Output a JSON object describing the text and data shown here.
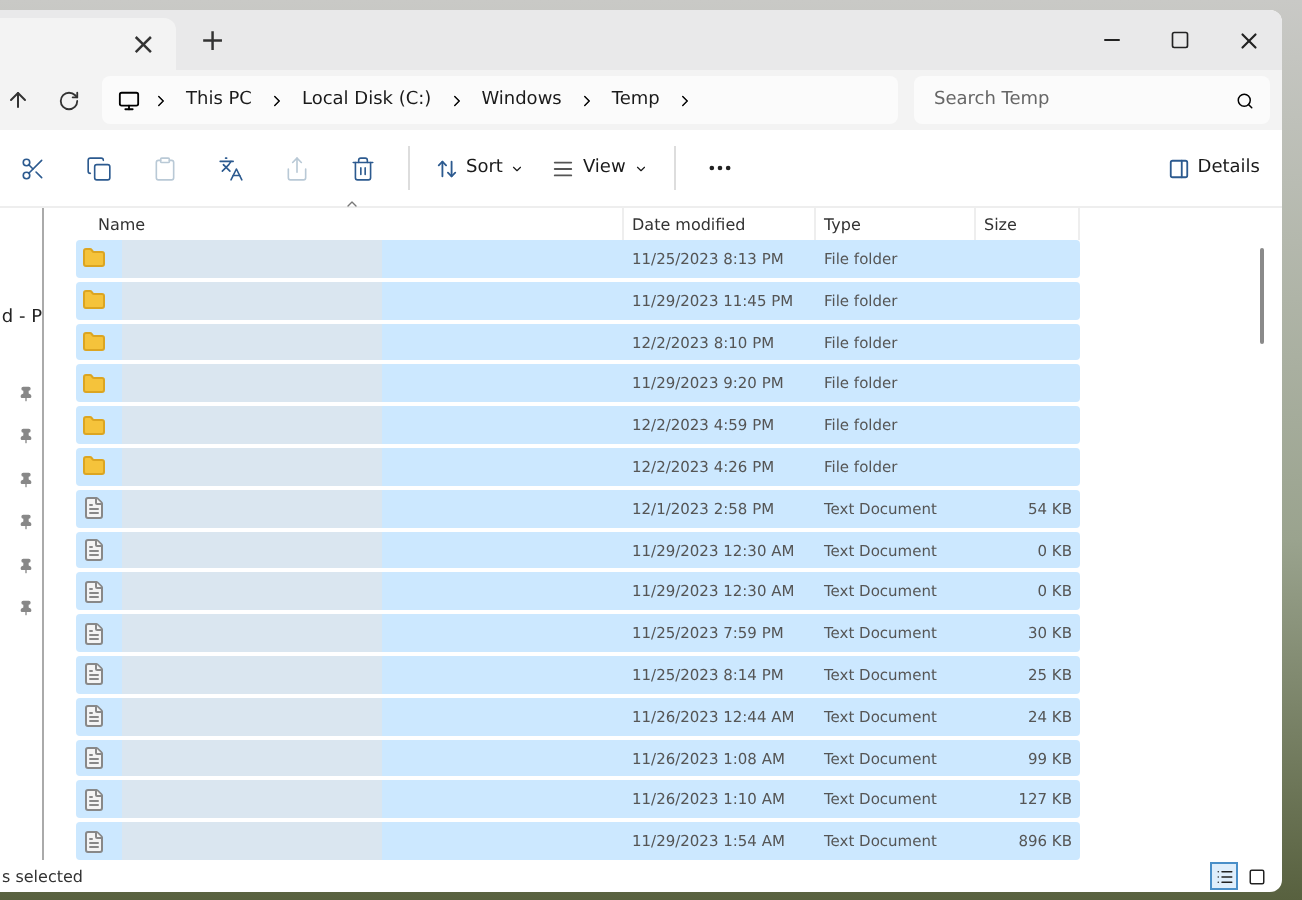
{
  "window": {
    "tab_close": "×",
    "new_tab": "+"
  },
  "address": {
    "crumbs": [
      "This PC",
      "Local Disk (C:)",
      "Windows",
      "Temp"
    ],
    "search_placeholder": "Search Temp"
  },
  "toolbar": {
    "actions": [
      {
        "kind": "cut",
        "disabled": false
      },
      {
        "kind": "copy",
        "disabled": false
      },
      {
        "kind": "paste",
        "disabled": true
      },
      {
        "kind": "rename",
        "disabled": false
      },
      {
        "kind": "share",
        "disabled": true
      },
      {
        "kind": "delete",
        "disabled": false
      }
    ],
    "sort": "Sort",
    "view": "View",
    "details": "Details"
  },
  "sidebar": {
    "fragment": "d - P",
    "items": [
      {
        "pinned": true
      },
      {
        "pinned": true
      },
      {
        "pinned": true
      },
      {
        "pinned": true
      },
      {
        "pinned": true
      },
      {
        "pinned": true
      }
    ]
  },
  "columns": [
    {
      "label": "Name",
      "sorted": true
    },
    {
      "label": "Date modified",
      "sorted": false
    },
    {
      "label": "Type",
      "sorted": false
    },
    {
      "label": "Size",
      "sorted": false
    }
  ],
  "rows": [
    {
      "kind": "folder",
      "date": "11/25/2023 8:13 PM",
      "type": "File folder",
      "size": "",
      "selected": true
    },
    {
      "kind": "folder",
      "date": "11/29/2023 11:45 PM",
      "type": "File folder",
      "size": "",
      "selected": true
    },
    {
      "kind": "folder",
      "date": "12/2/2023 8:10 PM",
      "type": "File folder",
      "size": "",
      "selected": true
    },
    {
      "kind": "folder",
      "date": "11/29/2023 9:20 PM",
      "type": "File folder",
      "size": "",
      "selected": true
    },
    {
      "kind": "folder",
      "date": "12/2/2023 4:59 PM",
      "type": "File folder",
      "size": "",
      "selected": true
    },
    {
      "kind": "folder",
      "date": "12/2/2023 4:26 PM",
      "type": "File folder",
      "size": "",
      "selected": true
    },
    {
      "kind": "text",
      "date": "12/1/2023 2:58 PM",
      "type": "Text Document",
      "size": "54 KB",
      "selected": true
    },
    {
      "kind": "text",
      "date": "11/29/2023 12:30 AM",
      "type": "Text Document",
      "size": "0 KB",
      "selected": true
    },
    {
      "kind": "text",
      "date": "11/29/2023 12:30 AM",
      "type": "Text Document",
      "size": "0 KB",
      "selected": true
    },
    {
      "kind": "text",
      "date": "11/25/2023 7:59 PM",
      "type": "Text Document",
      "size": "30 KB",
      "selected": true
    },
    {
      "kind": "text",
      "date": "11/25/2023 8:14 PM",
      "type": "Text Document",
      "size": "25 KB",
      "selected": true
    },
    {
      "kind": "text",
      "date": "11/26/2023 12:44 AM",
      "type": "Text Document",
      "size": "24 KB",
      "selected": true
    },
    {
      "kind": "text",
      "date": "11/26/2023 1:08 AM",
      "type": "Text Document",
      "size": "99 KB",
      "selected": true
    },
    {
      "kind": "text",
      "date": "11/26/2023 1:10 AM",
      "type": "Text Document",
      "size": "127 KB",
      "selected": true
    },
    {
      "kind": "text",
      "date": "11/29/2023 1:54 AM",
      "type": "Text Document",
      "size": "896 KB",
      "selected": true
    }
  ],
  "status_bar": {
    "text": "s selected",
    "views": [
      {
        "kind": "details",
        "selected": true
      },
      {
        "kind": "tiles",
        "selected": false
      }
    ]
  }
}
